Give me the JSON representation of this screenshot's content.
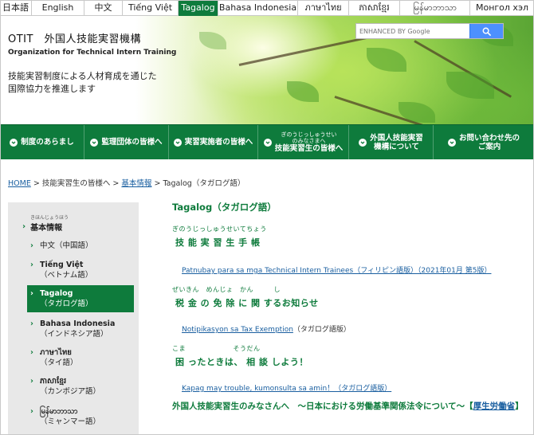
{
  "languages": [
    {
      "label": "日本語",
      "active": false
    },
    {
      "label": "English",
      "active": false
    },
    {
      "label": "中文",
      "active": false
    },
    {
      "label": "Tiếng Việt",
      "active": false
    },
    {
      "label": "Tagalog",
      "active": true
    },
    {
      "label": "Bahasa Indonesia",
      "active": false
    },
    {
      "label": "ภาษาไทย",
      "active": false
    },
    {
      "label": "ភាសាខ្មែរ",
      "active": false
    },
    {
      "label": "မြန်မာဘာသာ",
      "active": false
    },
    {
      "label": "Монгол хэл",
      "active": false
    }
  ],
  "header": {
    "title": "OTIT　外国人技能実習機構",
    "subtitle": "Organization for Technical Intern Training",
    "tagline_1": "技能実習制度による人材育成を通じた",
    "tagline_2": "国際協力を推進します"
  },
  "search": {
    "placeholder": "ENHANCED BY Google",
    "icon": "search-icon"
  },
  "nav": [
    {
      "label": "制度のあらまし"
    },
    {
      "label": "監理団体の皆様へ"
    },
    {
      "label": "実習実施者の皆様へ"
    },
    {
      "ruby_1": "ぎのうじっしゅうせい",
      "ruby_2": "のみなさまへ",
      "label": "技能実習生の皆様へ"
    },
    {
      "label_1": "外国人技能実習",
      "label_2": "機構について"
    },
    {
      "label_1": "お問い合わせ先の",
      "label_2": "ご案内"
    }
  ],
  "breadcrumb": {
    "home": "HOME",
    "sep": ">",
    "item_1": "技能実習生の皆様へ",
    "item_2": "基本情報",
    "current": "Tagalog（タガログ語）"
  },
  "sidebar": {
    "ruby": "きほんじょうほう",
    "heading": "基本情報",
    "items": [
      {
        "line_1": "中文（中国語）",
        "line_2": "",
        "active": false
      },
      {
        "line_1": "Tiếng Việt",
        "line_2": "（ベトナム語）",
        "active": false
      },
      {
        "line_1": "Tagalog",
        "line_2": "（タガログ語）",
        "active": true
      },
      {
        "line_1": "Bahasa Indonesia",
        "line_2": "（インドネシア語）",
        "active": false
      },
      {
        "line_1": "ภาษาไทย",
        "line_2": "（タイ語）",
        "active": false
      },
      {
        "line_1": "ភាសាខ្មែរ",
        "line_2": "（カンボジア語）",
        "active": false
      },
      {
        "line_1": "မြန်မာဘာသာ",
        "line_2": "（ミャンマー語）",
        "active": false
      }
    ]
  },
  "main": {
    "heading": "Tagalog（タガログ語）",
    "sections": [
      {
        "ruby": "ぎのうじっしゅうせいてちょう",
        "title": "技 能 実 習 生 手 帳",
        "link": "Patnubay para sa mga Technical Intern Trainees（フィリピン語版）（2021年01月 第5版）",
        "suffix": ""
      },
      {
        "ruby": "ぜいきん　めんじょ　かん　　　し",
        "title": "税 金 の 免 除 に 関 するお知らせ",
        "link": "Notipikasyon sa Tax Exemption",
        "suffix": "（タガログ語版）"
      },
      {
        "ruby": "こま　　　　　　　そうだん",
        "title": "困 ったときは、 相 談 しよう！",
        "link": "Kapag may trouble, kumonsulta sa amin！（タガログ語版）",
        "suffix": ""
      }
    ],
    "law_text": "外国人技能実習生のみなさんへ　～日本における労働基準関係法令について～【",
    "law_link": "厚生労働省",
    "law_end": "】"
  },
  "colors": {
    "brand_green": "#0e7b3c",
    "link_blue": "#1a5fa0",
    "sidebar_bg": "#e8e8e8"
  }
}
